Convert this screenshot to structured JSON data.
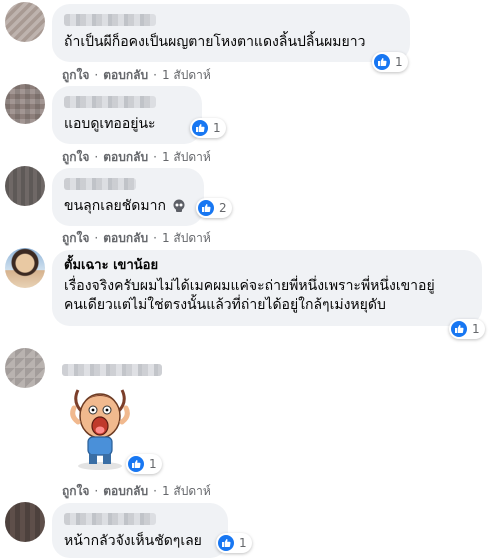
{
  "comments": [
    {
      "text": "ถ้าเป็นผีก็อคงเป็นผญตายโหงตาแดงลิ้นปลิ้นผมยาว",
      "like_count": "1",
      "actions": {
        "like": "ถูกใจ",
        "reply": "ตอบกลับ",
        "time": "1 สัปดาห์"
      }
    },
    {
      "text": "แอบดูเทออยู่นะ",
      "like_count": "1",
      "actions": {
        "like": "ถูกใจ",
        "reply": "ตอบกลับ",
        "time": "1 สัปดาห์"
      }
    },
    {
      "text": "ขนลุกเลยชัดมาก",
      "emoji": "skull-icon",
      "like_count": "2",
      "actions": {
        "like": "ถูกใจ",
        "reply": "ตอบกลับ",
        "time": "1 สัปดาห์"
      }
    },
    {
      "author": "ตั้มเฉาะ เขาน้อย",
      "lines": [
        "เรื่องจริงครับผมไม่ได้เมคผมแค่จะถ่ายพี่หนึ่งเพราะพี่หนึ่งเขาอยู่",
        "คนเดียวแต่ไม่ใช่ตรงนั้นแล้วที่ถ่ายได้อยู่ใกล้ๆเม่งหยุดับ"
      ],
      "like_count": "1"
    },
    {
      "sticker": "screaming-cartoon-sticker",
      "like_count": "1",
      "actions": {
        "like": "ถูกใจ",
        "reply": "ตอบกลับ",
        "time": "1 สัปดาห์"
      }
    },
    {
      "text": "หน้ากลัวจังเห็นชัดๆเลย",
      "like_count": "1"
    }
  ],
  "colors": {
    "like_blue": "#1877f2",
    "bubble_bg": "#f0f2f5",
    "meta_gray": "#65676b"
  }
}
